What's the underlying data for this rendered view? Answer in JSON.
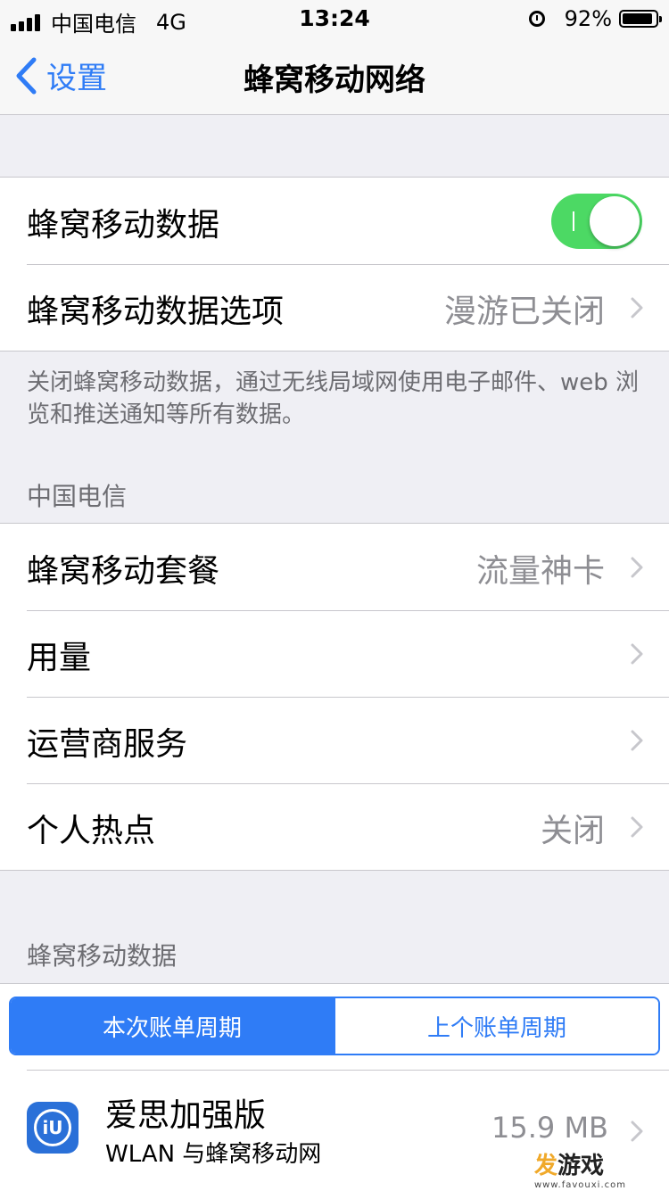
{
  "status_bar": {
    "carrier": "中国电信",
    "network": "4G",
    "time": "13:24",
    "battery": "92%",
    "battery_level": 0.92
  },
  "nav": {
    "back_label": "设置",
    "title": "蜂窝移动网络"
  },
  "group1": {
    "cellular_data": {
      "label": "蜂窝移动数据",
      "toggle_on": true
    },
    "data_options": {
      "label": "蜂窝移动数据选项",
      "detail": "漫游已关闭"
    }
  },
  "footer_note": "关闭蜂窝移动数据，通过无线局域网使用电子邮件、web 浏览和推送通知等所有数据。",
  "carrier_section": {
    "header": "中国电信",
    "plan": {
      "label": "蜂窝移动套餐",
      "detail": "流量神卡"
    },
    "usage": {
      "label": "用量"
    },
    "carrier_services": {
      "label": "运营商服务"
    },
    "hotspot": {
      "label": "个人热点",
      "detail": "关闭"
    }
  },
  "usage_section": {
    "header": "蜂窝移动数据",
    "segments": [
      "本次账单周期",
      "上个账单周期"
    ],
    "app": {
      "name": "爱思加强版",
      "subtitle": "WLAN 与蜂窝移动网",
      "size": "15.9 MB",
      "icon_text": "iU"
    }
  },
  "watermark": {
    "brand_first": "发",
    "brand_rest": "游戏",
    "url": "www.favouxi.com"
  },
  "colors": {
    "accent": "#2f7cf6",
    "toggle_on": "#4cd964",
    "background": "#efeff4"
  }
}
